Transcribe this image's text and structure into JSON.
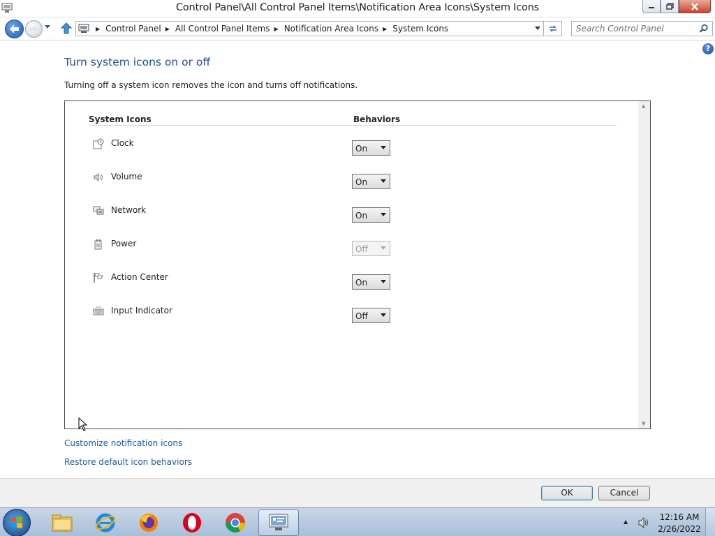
{
  "window": {
    "title": "Control Panel\\All Control Panel Items\\Notification Area Icons\\System Icons"
  },
  "address": {
    "crumbs": [
      "Control Panel",
      "All Control Panel Items",
      "Notification Area Icons",
      "System Icons"
    ]
  },
  "search": {
    "placeholder": "Search Control Panel"
  },
  "content": {
    "heading": "Turn system icons on or off",
    "description": "Turning off a system icon removes the icon and turns off notifications.",
    "col_icons": "System Icons",
    "col_behaviors": "Behaviors",
    "rows": [
      {
        "label": "Clock",
        "value": "On",
        "icon": "clock-icon"
      },
      {
        "label": "Volume",
        "value": "On",
        "icon": "volume-icon"
      },
      {
        "label": "Network",
        "value": "On",
        "icon": "network-icon"
      },
      {
        "label": "Power",
        "value": "Off",
        "icon": "power-icon",
        "disabled": true
      },
      {
        "label": "Action Center",
        "value": "On",
        "icon": "flag-icon"
      },
      {
        "label": "Input Indicator",
        "value": "Off",
        "icon": "keyboard-icon"
      }
    ],
    "link_customize": "Customize notification icons",
    "link_restore": "Restore default icon behaviors"
  },
  "footer": {
    "ok_label": "OK",
    "cancel_label": "Cancel"
  },
  "taskbar": {
    "apps": [
      "file-explorer-icon",
      "internet-explorer-icon",
      "firefox-icon",
      "opera-icon",
      "chrome-icon",
      "control-panel-icon"
    ],
    "time": "12:16 AM",
    "date": "2/26/2022"
  },
  "colors": {
    "heading": "#1f4e9a",
    "link": "#1f5aa6",
    "taskbar": "#a9bfd8"
  }
}
